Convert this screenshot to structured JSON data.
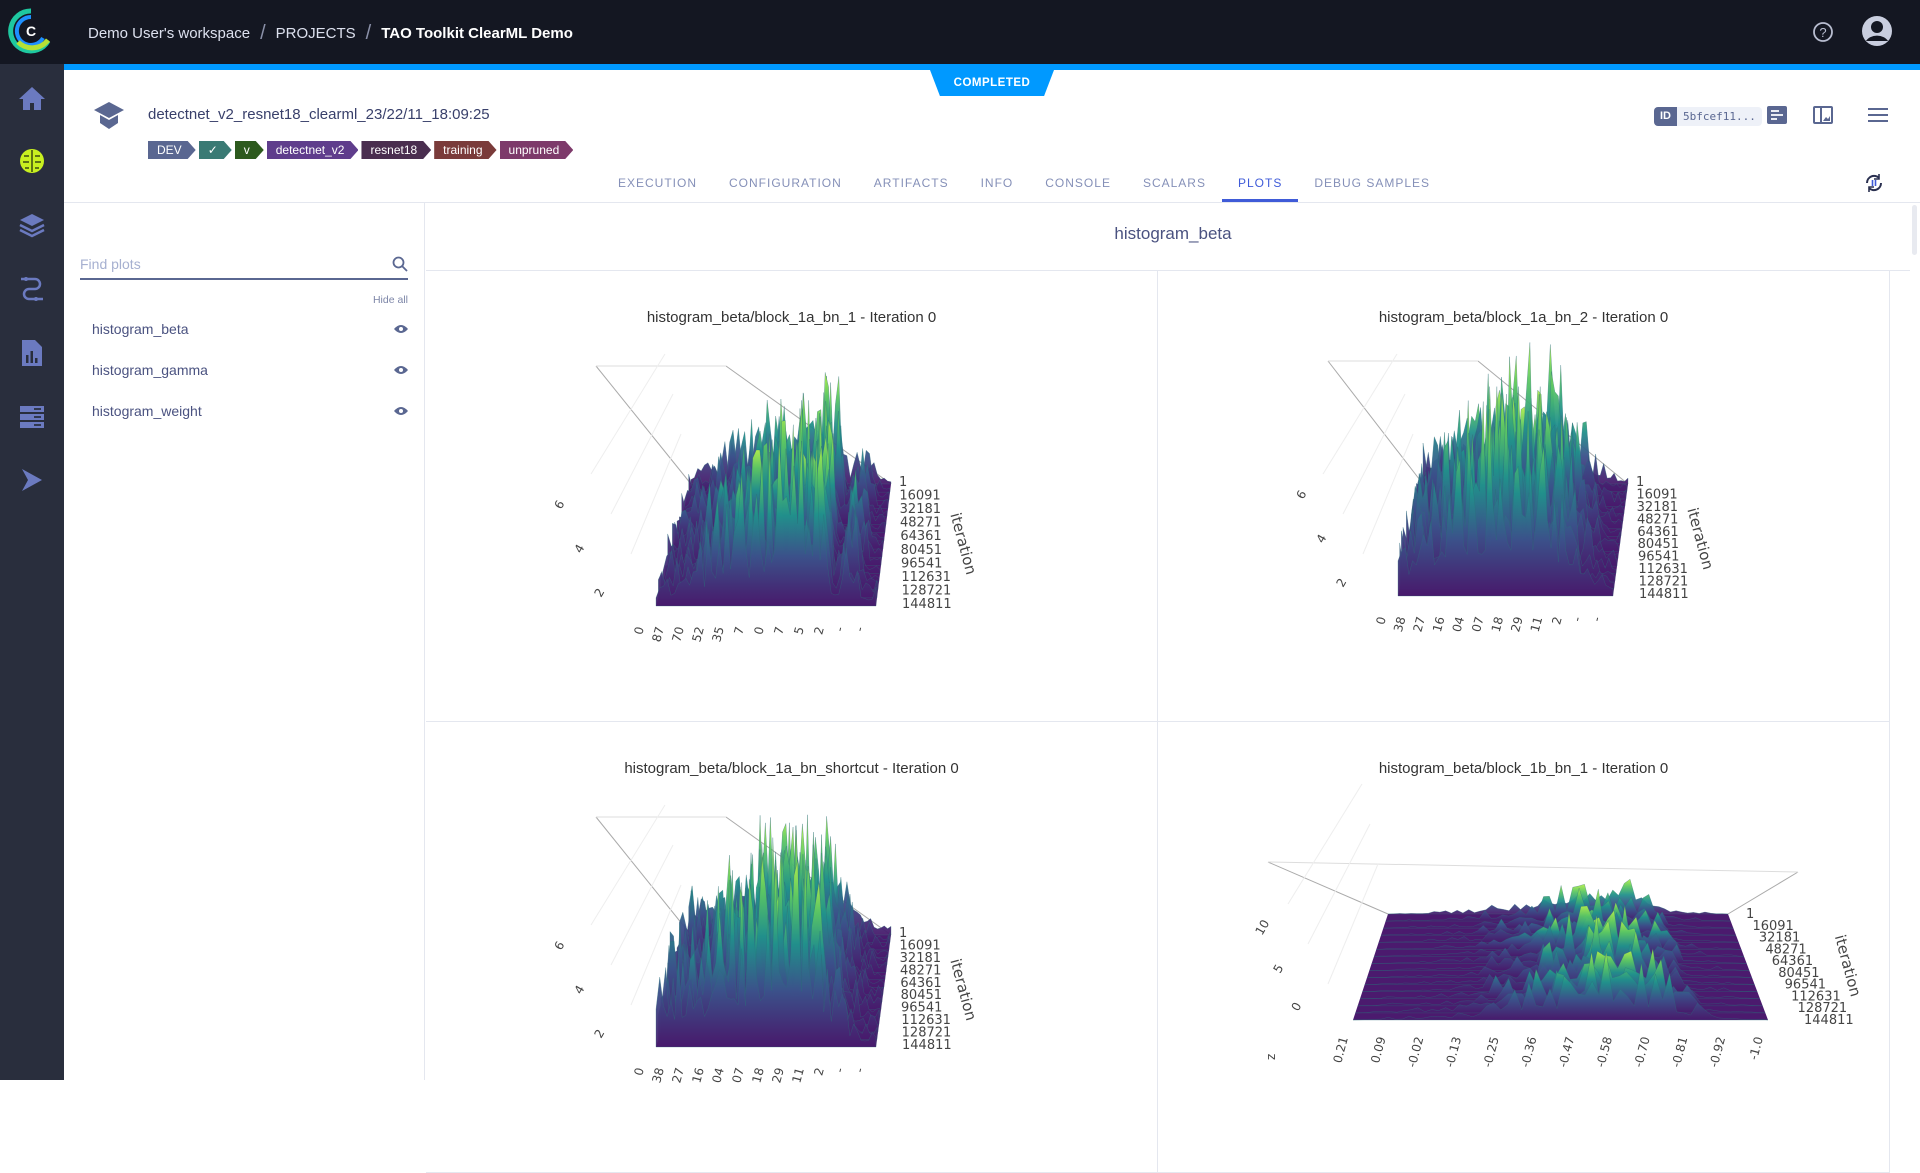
{
  "breadcrumb": {
    "workspace": "Demo User's workspace",
    "projects": "PROJECTS",
    "project": "TAO Toolkit ClearML Demo"
  },
  "status": "COMPLETED",
  "task": {
    "title": "detectnet_v2_resnet18_clearml_23/22/11_18:09:25",
    "id_label": "ID",
    "id_value": "5bfcef11...",
    "tags": [
      {
        "label": "DEV",
        "color": "#5a6791"
      },
      {
        "label": "✓",
        "color": "#3a7a74"
      },
      {
        "label": "v",
        "color": "#2d5a1e"
      },
      {
        "label": "detectnet_v2",
        "color": "#5f3d8c"
      },
      {
        "label": "resnet18",
        "color": "#4a2e4f"
      },
      {
        "label": "training",
        "color": "#7a3b3a"
      },
      {
        "label": "unpruned",
        "color": "#7d3a6a"
      }
    ]
  },
  "tabs": [
    "EXECUTION",
    "CONFIGURATION",
    "ARTIFACTS",
    "INFO",
    "CONSOLE",
    "SCALARS",
    "PLOTS",
    "DEBUG SAMPLES"
  ],
  "active_tab": "PLOTS",
  "left_panel": {
    "search_placeholder": "Find plots",
    "hide_all": "Hide all",
    "items": [
      {
        "label": "histogram_beta",
        "icon": "eye-icon"
      },
      {
        "label": "histogram_gamma",
        "icon": "eye-icon"
      },
      {
        "label": "histogram_weight",
        "icon": "eye-icon"
      }
    ]
  },
  "main": {
    "group_title": "histogram_beta"
  },
  "colors": {
    "accent": "#0099ff",
    "topbar": "#141722",
    "sidenav": "#292e3d",
    "active_tab": "#3f5bd8"
  },
  "chart_data": [
    {
      "type": "surface",
      "title": "histogram_beta/block_1a_bn_1 - Iteration 0",
      "ylabel": "iteration",
      "y_ticks": [
        "1",
        "16091",
        "32181",
        "48271",
        "64361",
        "80451",
        "96541",
        "112631",
        "128721",
        "144811"
      ],
      "z_ticks": [
        "2",
        "4",
        "6"
      ],
      "x_ticks": [
        "0",
        "87",
        "70",
        "52",
        "35",
        "7",
        "0",
        "7",
        "5",
        "2",
        "-",
        "-"
      ],
      "colorscale": "viridis"
    },
    {
      "type": "surface",
      "title": "histogram_beta/block_1a_bn_2 - Iteration 0",
      "ylabel": "iteration",
      "y_ticks": [
        "1",
        "16091",
        "32181",
        "48271",
        "64361",
        "80451",
        "96541",
        "112631",
        "128721",
        "144811"
      ],
      "z_ticks": [
        "2",
        "4",
        "6"
      ],
      "x_ticks": [
        "0",
        "38",
        "27",
        "16",
        "04",
        "07",
        "18",
        "29",
        "11",
        "2",
        "-",
        "-"
      ],
      "colorscale": "viridis"
    },
    {
      "type": "surface",
      "title": "histogram_beta/block_1a_bn_shortcut - Iteration 0",
      "ylabel": "iteration",
      "y_ticks": [
        "1",
        "16091",
        "32181",
        "48271",
        "64361",
        "80451",
        "96541",
        "112631",
        "128721",
        "144811"
      ],
      "z_ticks": [
        "2",
        "4",
        "6"
      ],
      "x_ticks": [
        "0",
        "38",
        "27",
        "16",
        "04",
        "07",
        "18",
        "29",
        "11",
        "2",
        "-",
        "-"
      ],
      "colorscale": "viridis"
    },
    {
      "type": "surface",
      "title": "histogram_beta/block_1b_bn_1 - Iteration 0",
      "ylabel": "iteration",
      "zlabel": "z",
      "y_ticks": [
        "1",
        "16091",
        "32181",
        "48271",
        "64361",
        "80451",
        "96541",
        "112631",
        "128721",
        "144811"
      ],
      "z_ticks": [
        "0",
        "5",
        "10"
      ],
      "x_ticks": [
        "0.21",
        "0.09",
        "-0.02",
        "-0.13",
        "-0.25",
        "-0.36",
        "-0.47",
        "-0.58",
        "-0.70",
        "-0.81",
        "-0.92",
        "-1.0"
      ],
      "colorscale": "viridis"
    }
  ]
}
